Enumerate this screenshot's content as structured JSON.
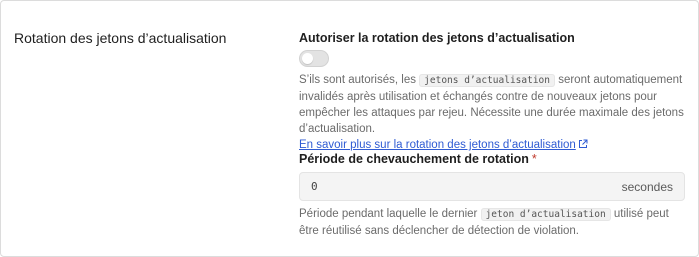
{
  "section": {
    "title": "Rotation des jetons d’actualisation"
  },
  "rotation": {
    "label": "Autoriser la rotation des jetons d’actualisation",
    "enabled": false,
    "help_before": "S’ils sont autorisés, les ",
    "help_code": "jetons d’actualisation",
    "help_after": " seront automatiquement invalidés après utilisation et échangés contre de nouveaux jetons pour empêcher les attaques par rejeu. Nécessite une durée maximale des jetons d’actualisation.",
    "link_text": "En savoir plus sur la rotation des jetons d’actualisation",
    "link_icon": "external-link-icon"
  },
  "overlap": {
    "label": "Période de chevauchement de rotation",
    "required_mark": "*",
    "value": "0",
    "suffix": "secondes",
    "help_before": "Période pendant laquelle le dernier ",
    "help_code": "jeton d’actualisation",
    "help_after": " utilisé peut être réutilisé sans déclencher de détection de violation."
  }
}
